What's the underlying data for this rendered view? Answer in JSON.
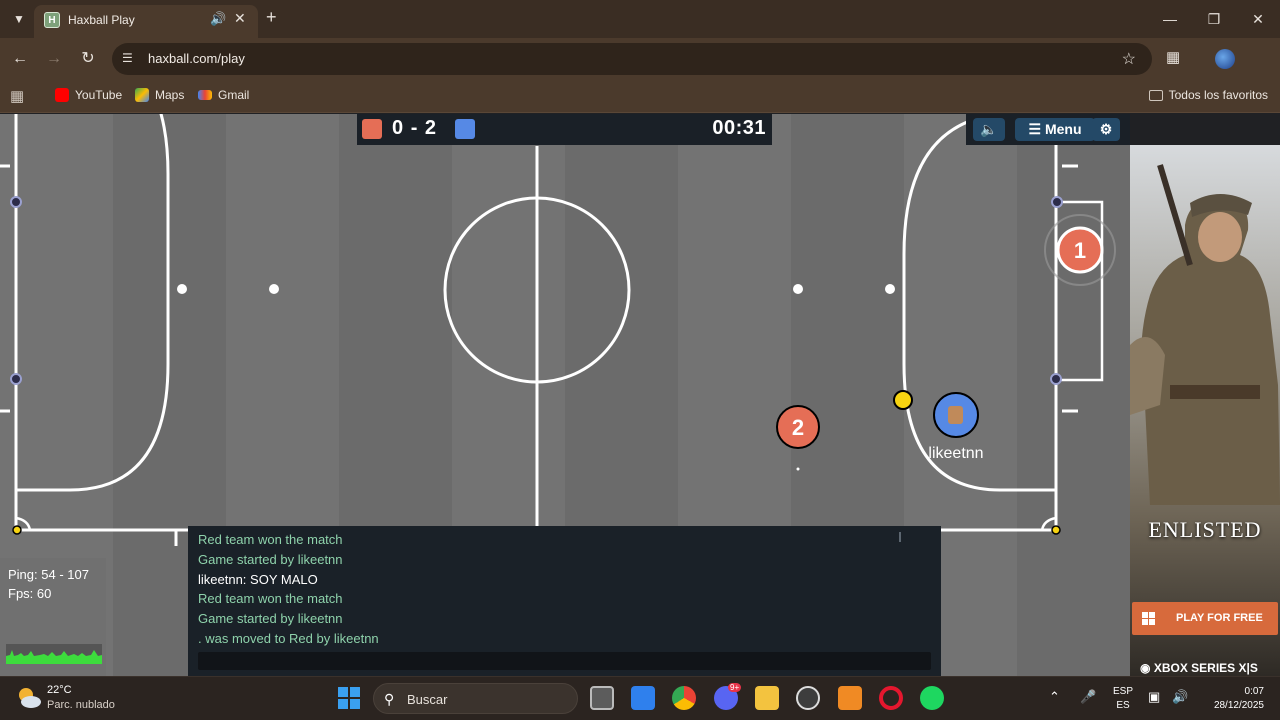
{
  "browser": {
    "tab_title": "Haxball Play",
    "tab_favicon_letter": "H",
    "url": "haxball.com/play",
    "bookmarks": [
      {
        "label": "YouTube",
        "color": "#ff0000"
      },
      {
        "label": "Maps",
        "color": "#34a853"
      },
      {
        "label": "Gmail",
        "color": "#ea4335"
      }
    ],
    "all_bookmarks_label": "Todos los favoritos"
  },
  "game": {
    "score_red": "0",
    "score_blue": "2",
    "score_separator": "-",
    "timer": "00:31",
    "menu_label": "Menu",
    "team_colors": {
      "red": "#e56e56",
      "blue": "#5689e5",
      "ball": "#f7d411"
    },
    "players": [
      {
        "number": "1",
        "team": "red"
      },
      {
        "number": "2",
        "team": "red"
      },
      {
        "name": "likeetnn",
        "team": "blue"
      }
    ],
    "ping": "Ping: 54 - 107",
    "fps": "Fps: 60",
    "chat": [
      {
        "type": "notice",
        "text": "Red team won the match"
      },
      {
        "type": "notice",
        "text": "Game started by likeetnn"
      },
      {
        "type": "message",
        "text": "likeetnn: SOY MALO"
      },
      {
        "type": "notice",
        "text": "Red team won the match"
      },
      {
        "type": "notice",
        "text": "Game started by likeetnn"
      },
      {
        "type": "notice",
        "text": ". was moved to Red by likeetnn"
      }
    ]
  },
  "ad": {
    "brand": "ENLISTED",
    "cta": "PLAY FOR FREE",
    "platform": "XBOX SERIES X|S",
    "cta_color": "#d76a3c"
  },
  "taskbar": {
    "temperature": "22°C",
    "weather": "Parc. nublado",
    "search_label": "Buscar",
    "lang_line1": "ESP",
    "lang_line2": "ES",
    "time": "0:07",
    "date": "28/12/2025",
    "discord_badge": "9+"
  }
}
